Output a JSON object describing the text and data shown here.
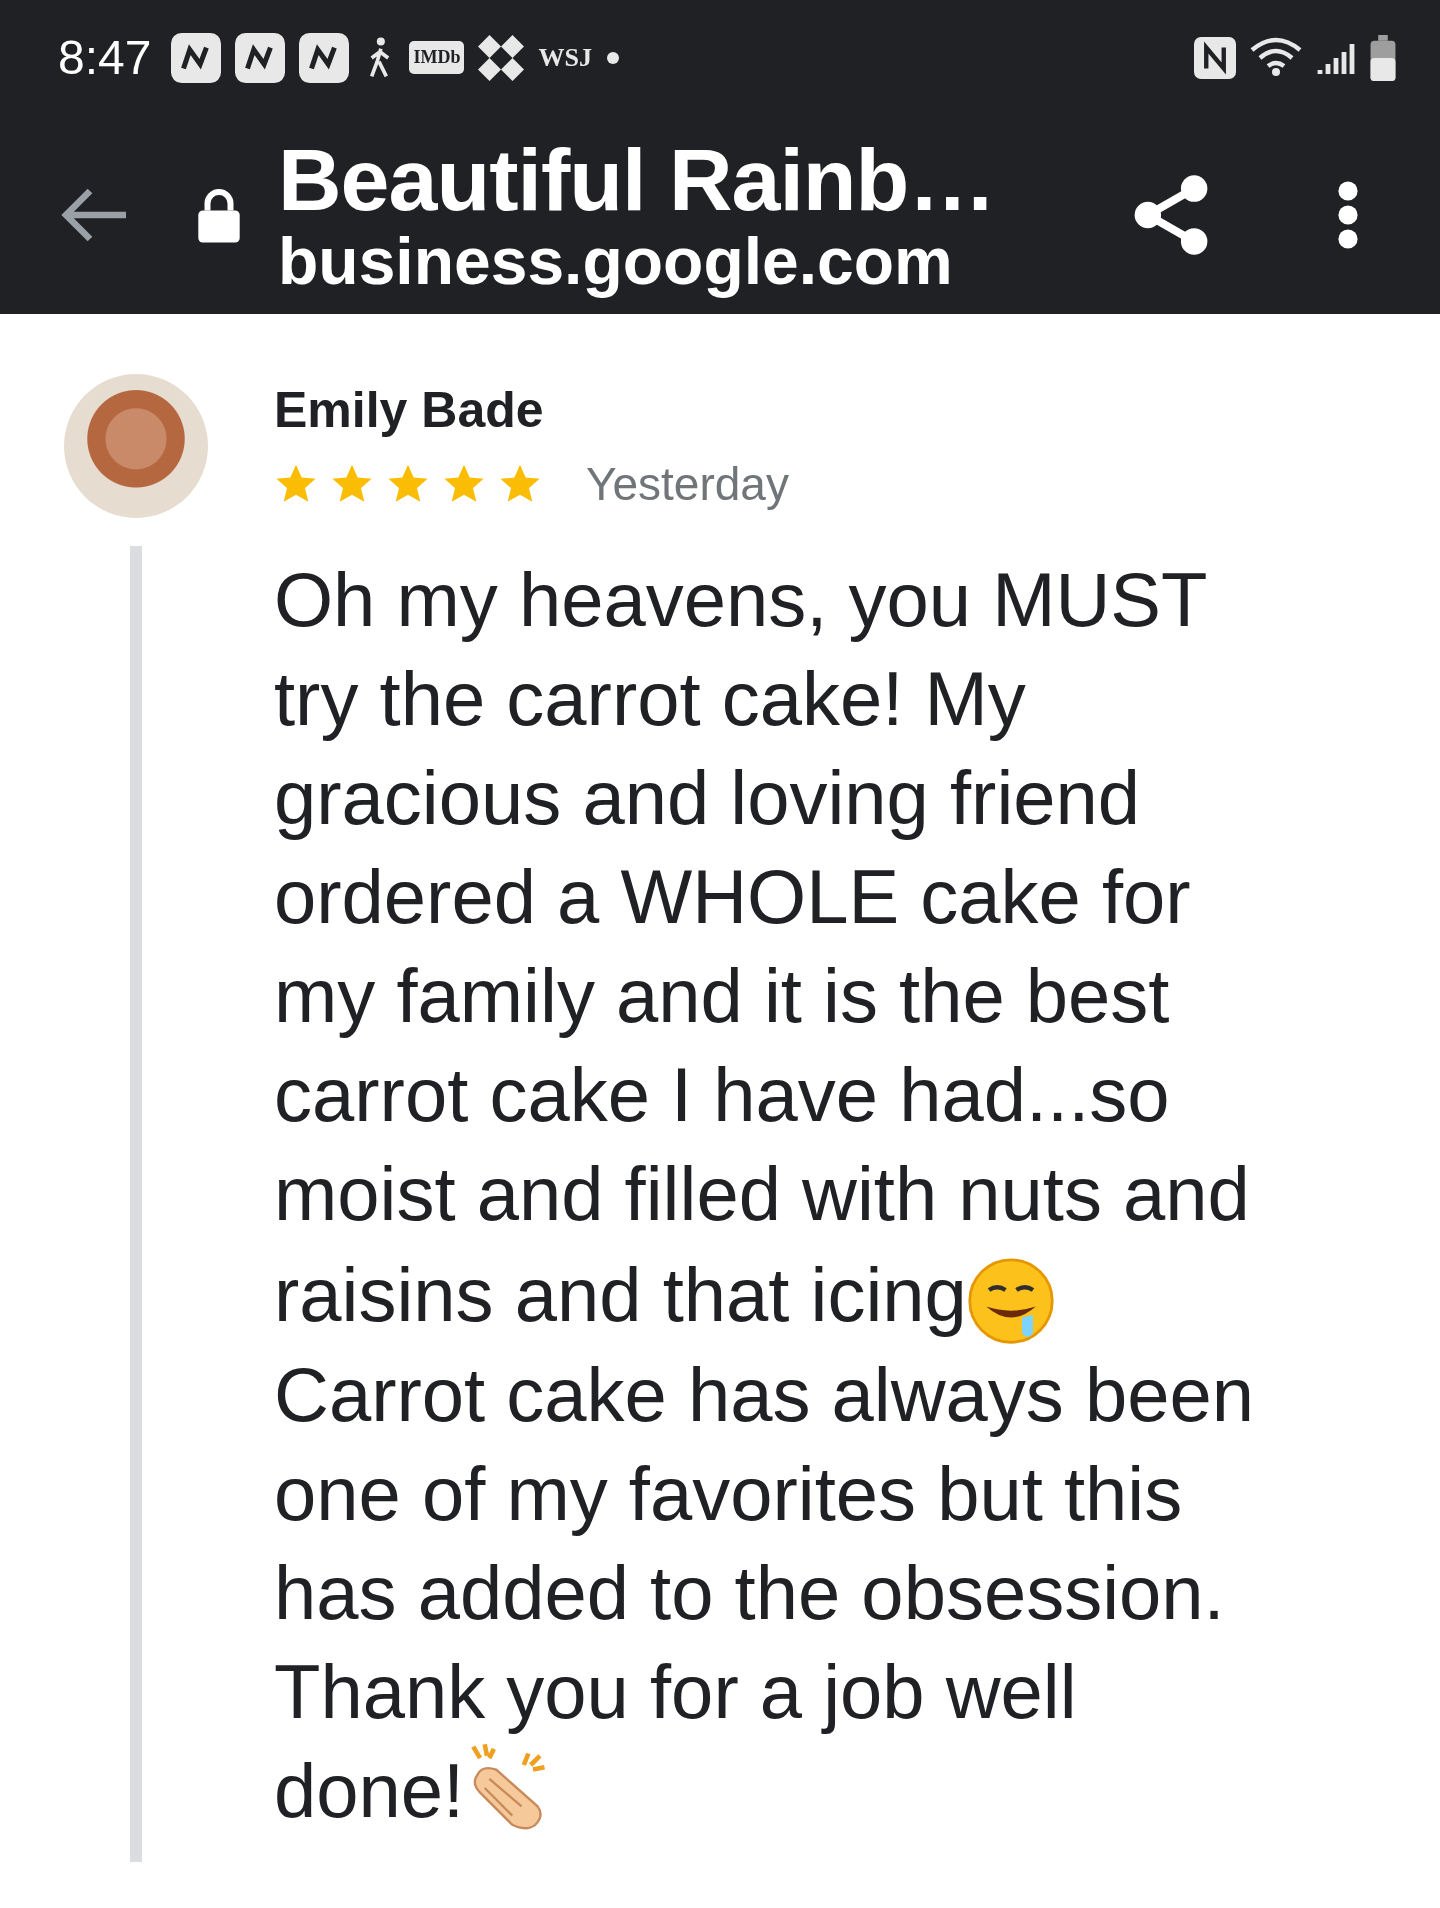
{
  "status_bar": {
    "time": "8:47",
    "app_badges": [
      "IMDb",
      "WSJ"
    ]
  },
  "header": {
    "title": "Beautiful Rainb…",
    "url": "business.google.com"
  },
  "review": {
    "author": "Emily Bade",
    "stars": 5,
    "date": "Yesterday",
    "lines": [
      {
        "text": "Oh my heavens, you MUST",
        "kind": "plain"
      },
      {
        "text": "try the carrot cake! My",
        "kind": "plain"
      },
      {
        "text": "gracious and loving friend",
        "kind": "plain"
      },
      {
        "text": "ordered a WHOLE cake for",
        "kind": "plain"
      },
      {
        "text": "my family and it is the best",
        "kind": "plain"
      },
      {
        "text": "carrot cake I have had...so",
        "kind": "plain"
      },
      {
        "text": "moist and filled with nuts and",
        "kind": "plain"
      },
      {
        "text": "raisins and that icing",
        "kind": "drooling"
      },
      {
        "text": "Carrot cake has always been",
        "kind": "plain"
      },
      {
        "text": "one of my favorites but this",
        "kind": "plain"
      },
      {
        "text": "has added to the obsession.",
        "kind": "plain"
      },
      {
        "text": "Thank you for a job well",
        "kind": "plain"
      },
      {
        "text": "done!",
        "kind": "clapping"
      }
    ]
  }
}
